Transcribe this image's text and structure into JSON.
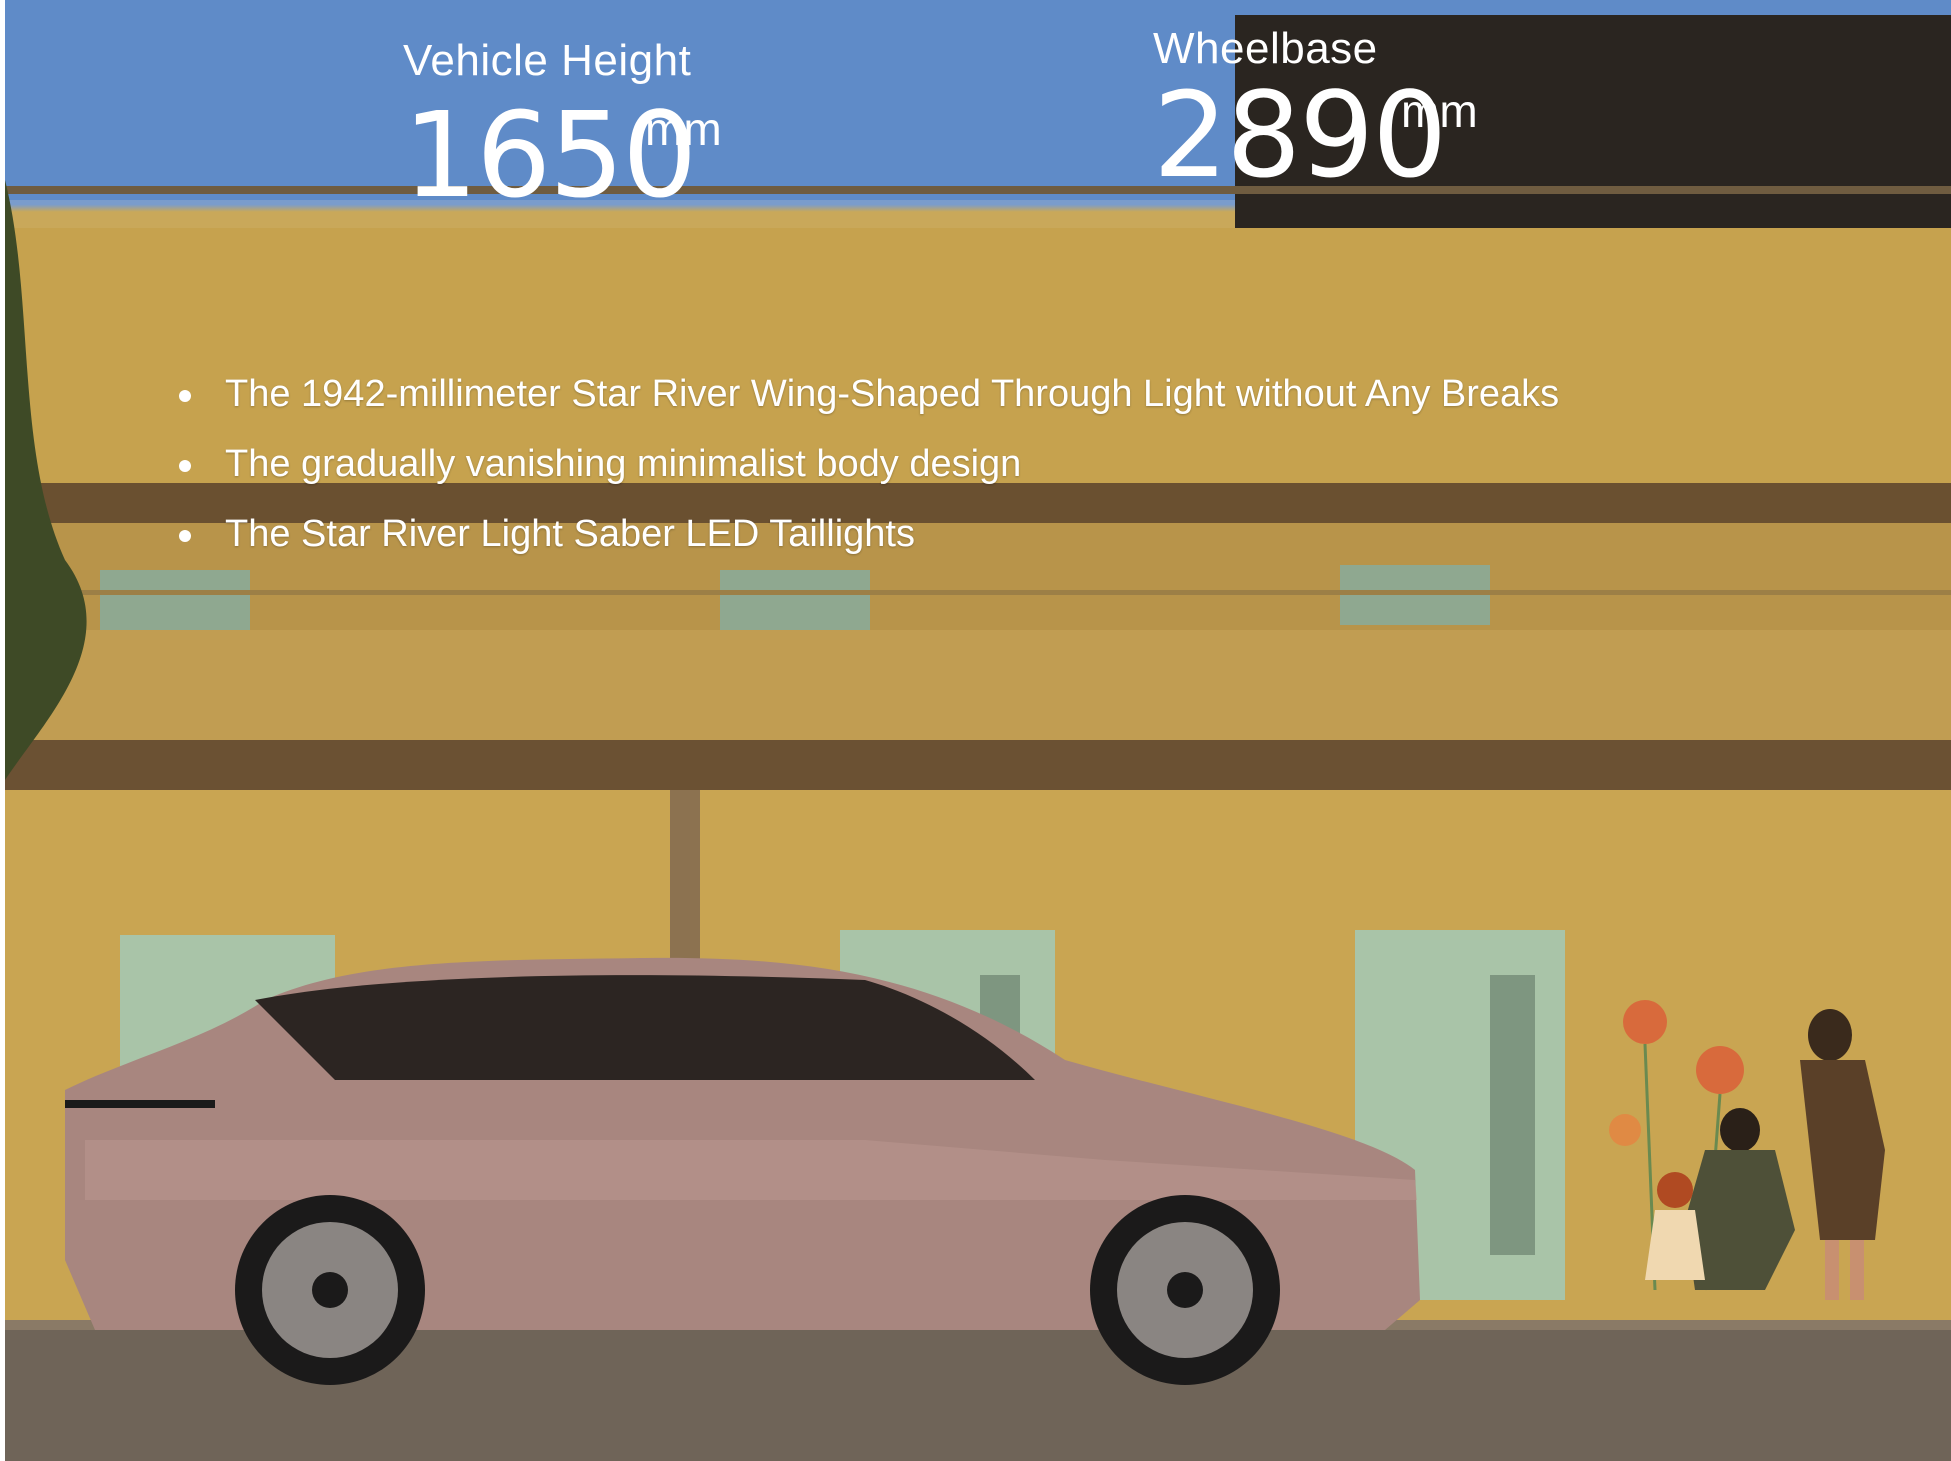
{
  "specs": {
    "height": {
      "label": "Vehicle Height",
      "value": "1650",
      "unit": "mm"
    },
    "wheelbase": {
      "label": "Wheelbase",
      "value": "2890",
      "unit": "mm"
    }
  },
  "features": [
    "The 1942-millimeter Star River Wing-Shaped Through Light without Any Breaks",
    "The gradually vanishing minimalist body design",
    "The Star River Light Saber LED Taillights"
  ],
  "colors": {
    "sky": "#5a86c4",
    "wall": "#c8a453",
    "car_body": "#a8867f",
    "door": "#a8c4aa",
    "text": "#ffffff"
  },
  "icons": [
    "flower-drawing-icon"
  ]
}
